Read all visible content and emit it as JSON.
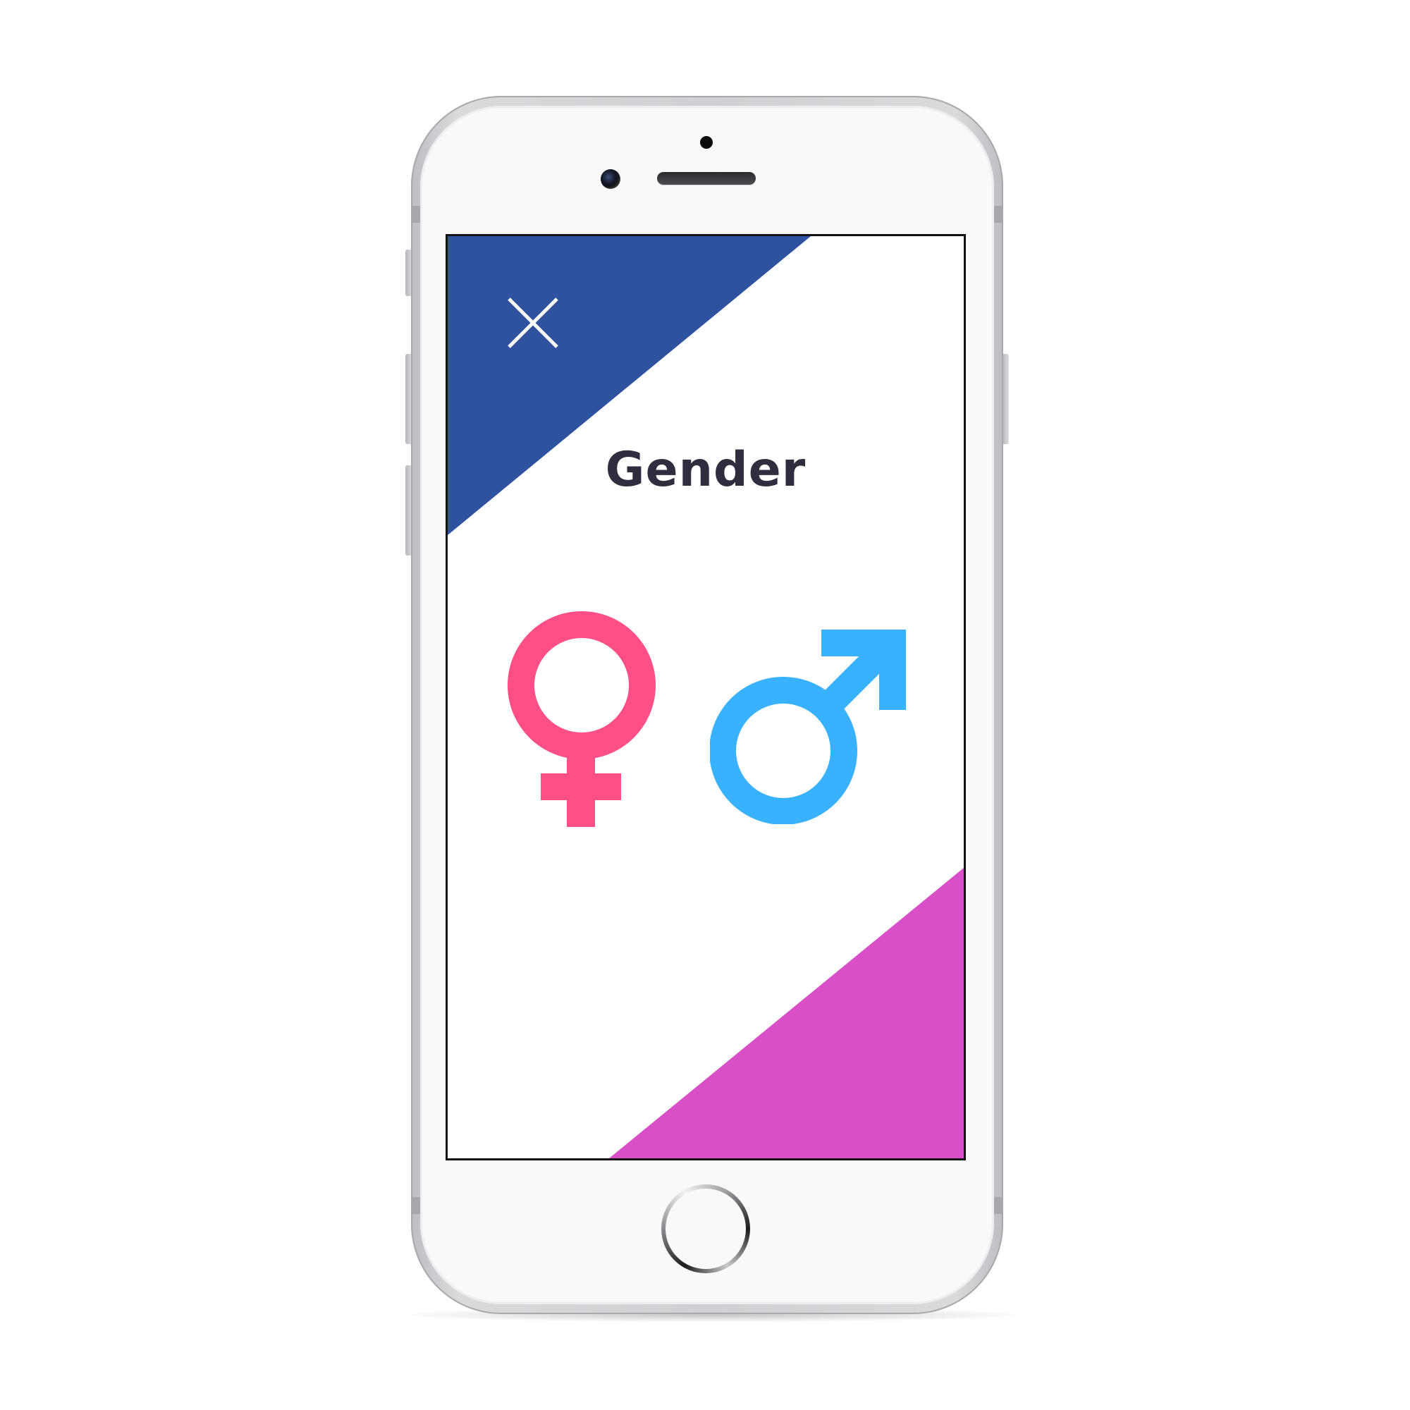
{
  "screen": {
    "title": "Gender"
  },
  "options": [
    {
      "id": "female",
      "icon": "female-symbol-icon",
      "color": "#ff4f86"
    },
    {
      "id": "male",
      "icon": "male-symbol-icon",
      "color": "#38b1ff"
    }
  ],
  "close": {
    "icon": "close-icon",
    "color": "#ffffff"
  },
  "colors": {
    "top_banner": "#2f52a0",
    "bottom_banner": "#d94fc8",
    "screen_background": "#ffffff",
    "title_text": "#2f2e3f",
    "phone_body": "#cfd0d3"
  }
}
